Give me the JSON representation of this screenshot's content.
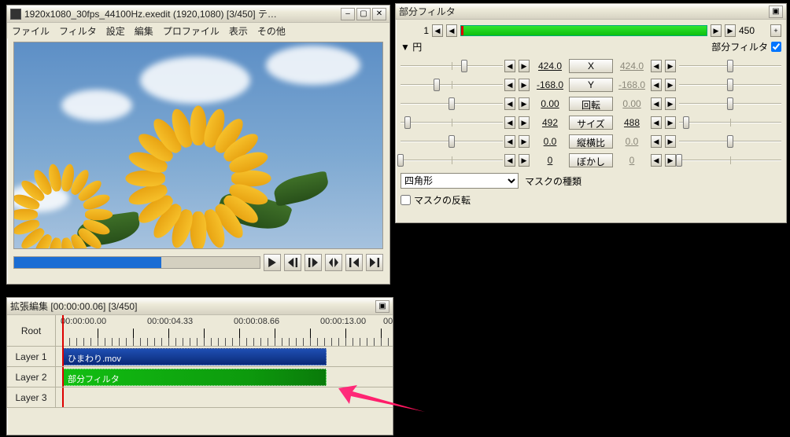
{
  "main": {
    "title": "1920x1080_30fps_44100Hz.exedit (1920,1080) [3/450] テ…",
    "menus": [
      "ファイル",
      "フィルタ",
      "設定",
      "編集",
      "プロファイル",
      "表示",
      "その他"
    ],
    "seek_fill_pct": "60%",
    "playback_icons": [
      "play",
      "frame-back",
      "frame-fwd",
      "stop",
      "skip-start",
      "skip-end"
    ]
  },
  "timeline": {
    "title": "拡張編集 [00:00:00.06] [3/450]",
    "root": "Root",
    "times": [
      "00:00:00.00",
      "00:00:04.33",
      "00:00:08.66",
      "00:00:13.00",
      "00"
    ],
    "layers": [
      "Layer 1",
      "Layer 2",
      "Layer 3"
    ],
    "clips": {
      "l1": "ひまわり.mov",
      "l2": "部分フィルタ"
    }
  },
  "filter": {
    "title": "部分フィルタ",
    "frame_from": "1",
    "frame_to": "450",
    "section_label": "円",
    "toggle_label": "部分フィルタ",
    "toggle_checked": true,
    "params": [
      {
        "name": "X",
        "a": "424.0",
        "b": "424.0",
        "sl": 0.62,
        "sr": 0.5,
        "gray_b": true
      },
      {
        "name": "Y",
        "a": "-168.0",
        "b": "-168.0",
        "sl": 0.35,
        "sr": 0.5,
        "gray_b": true
      },
      {
        "name": "回転",
        "a": "0.00",
        "b": "0.00",
        "sl": 0.5,
        "sr": 0.5,
        "gray_b": true
      },
      {
        "name": "サイズ",
        "a": "492",
        "b": "488",
        "sl": 0.07,
        "sr": 0.07,
        "gray_b": false
      },
      {
        "name": "縦横比",
        "a": "0.0",
        "b": "0.0",
        "sl": 0.5,
        "sr": 0.5,
        "gray_b": true
      },
      {
        "name": "ぼかし",
        "a": "0",
        "b": "0",
        "sl": 0.0,
        "sr": 0.0,
        "gray_b": true
      }
    ],
    "mask_type_label": "マスクの種類",
    "mask_type_value": "四角形",
    "mask_invert_label": "マスクの反転",
    "mask_invert_checked": false
  }
}
